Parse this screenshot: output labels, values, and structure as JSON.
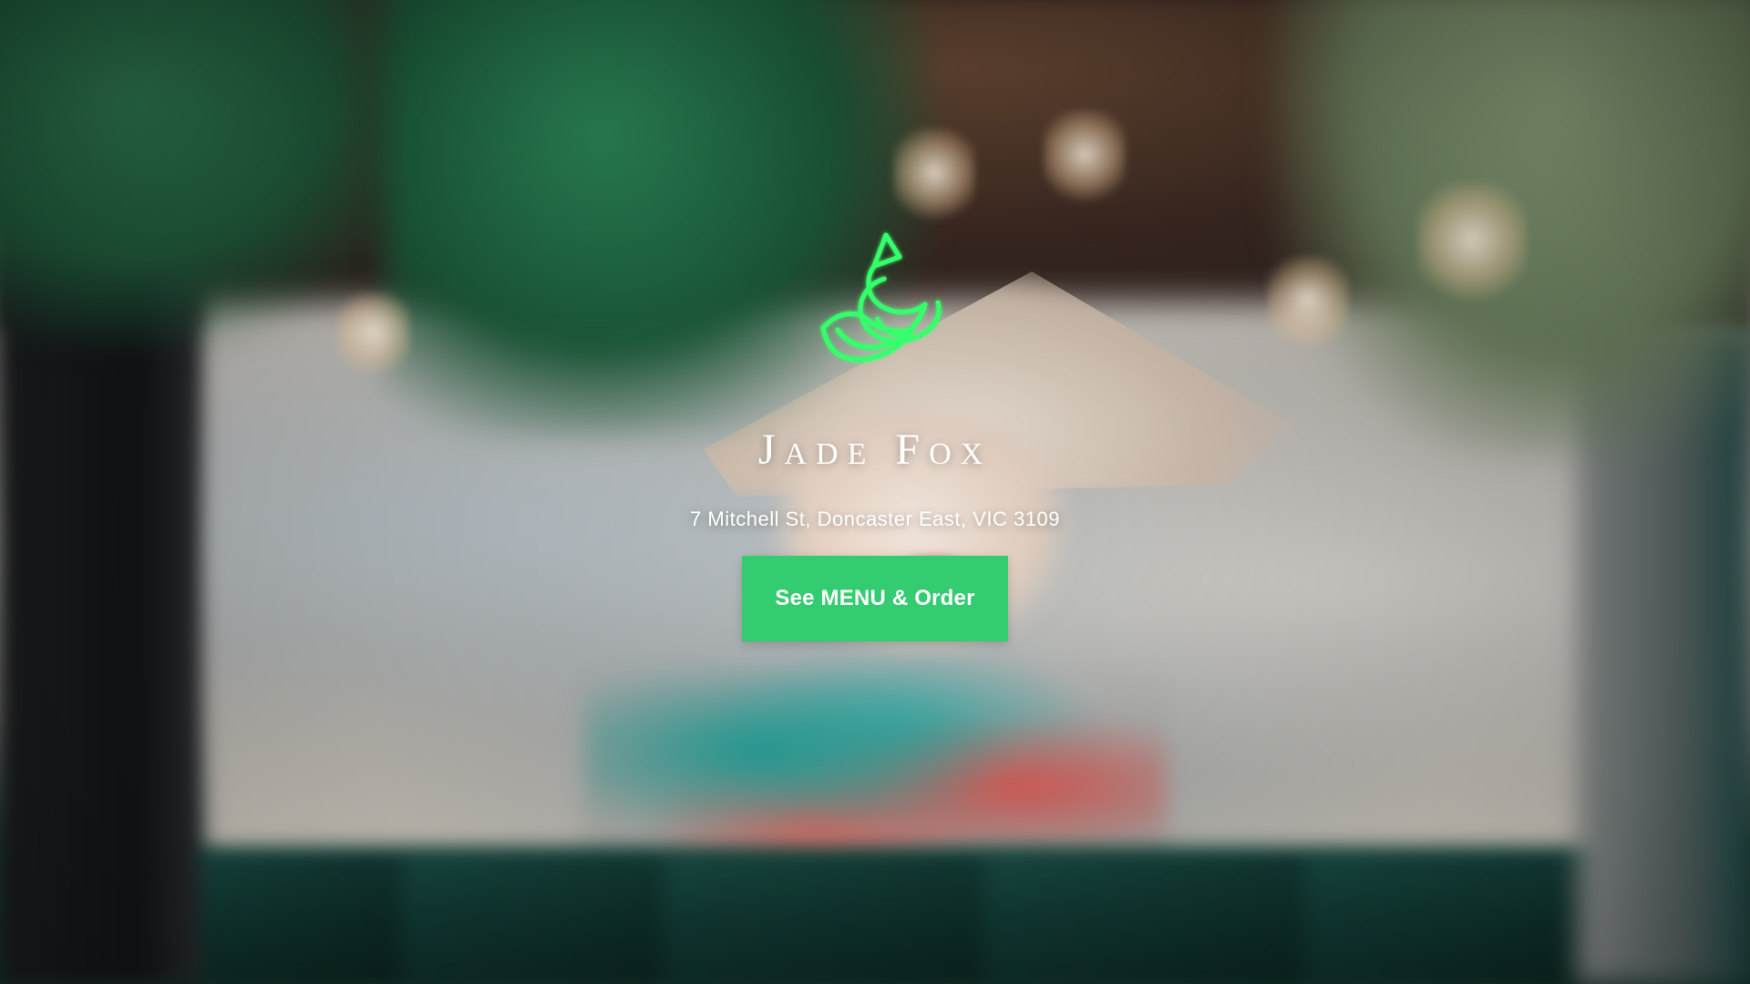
{
  "brand": {
    "name": "Jade Fox",
    "logo_icon": "fox-icon"
  },
  "location": {
    "address": "7 Mitchell St, Doncaster East, VIC 3109"
  },
  "actions": {
    "menu_order_label": "See MENU & Order"
  },
  "theme": {
    "accent": "#33cc70",
    "neon_green": "#36ff6a",
    "text": "#ffffff"
  }
}
